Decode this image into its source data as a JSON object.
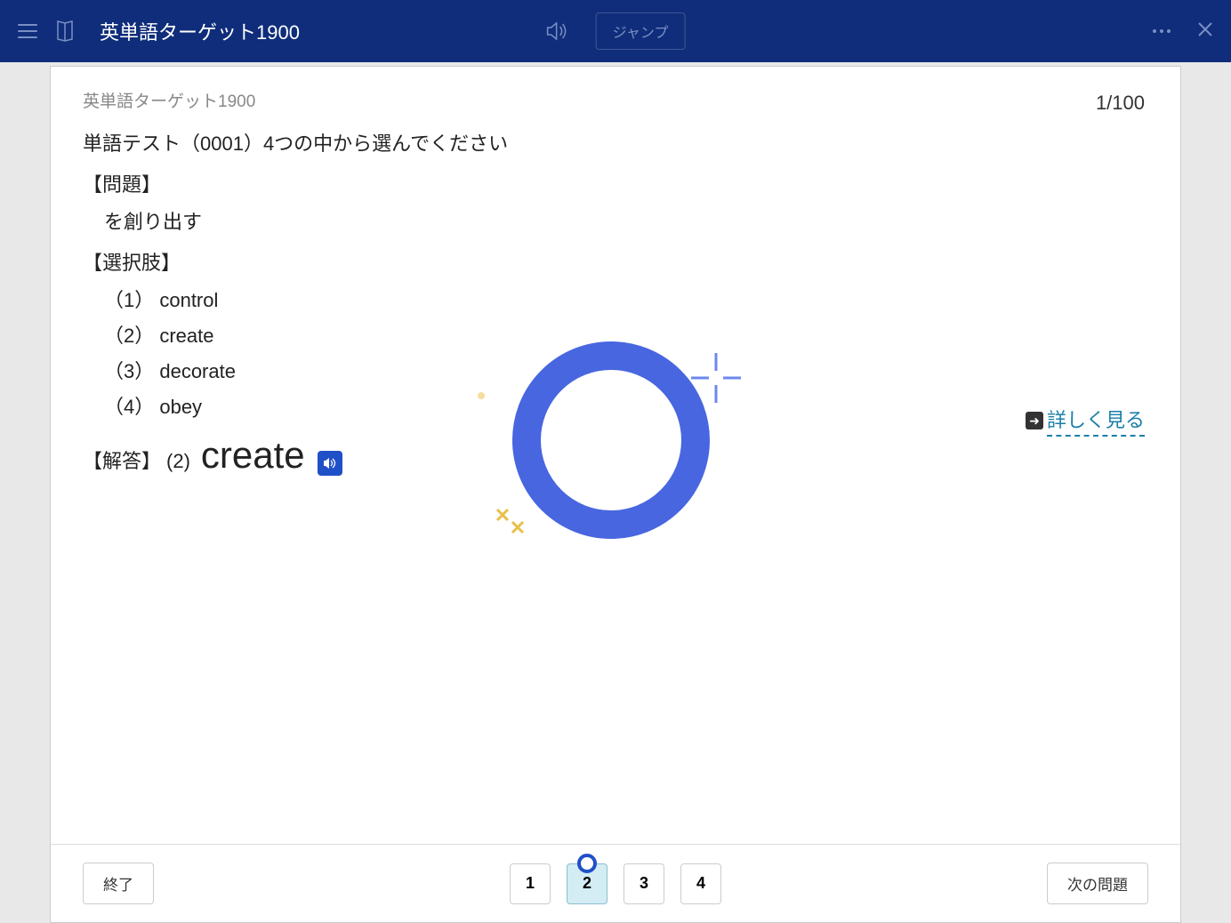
{
  "header": {
    "title": "英単語ターゲット1900",
    "jump_label": "ジャンプ"
  },
  "content": {
    "breadcrumb": "英単語ターゲット1900",
    "progress": "1/100",
    "instruction": "単語テスト（0001）4つの中から選んでください",
    "question_label": "【問題】",
    "question_text": "を創り出す",
    "choices_label": "【選択肢】",
    "choices": [
      {
        "num": "（1）",
        "text": "control"
      },
      {
        "num": "（2）",
        "text": "create"
      },
      {
        "num": "（3）",
        "text": "decorate"
      },
      {
        "num": "（4）",
        "text": "obey"
      }
    ],
    "answer_label": "【解答】",
    "answer_num": "(2)",
    "answer_word": "create",
    "detail_link": "詳しく見る"
  },
  "footer": {
    "exit_label": "終了",
    "buttons": [
      "1",
      "2",
      "3",
      "4"
    ],
    "selected_index": 1,
    "next_label": "次の問題"
  }
}
